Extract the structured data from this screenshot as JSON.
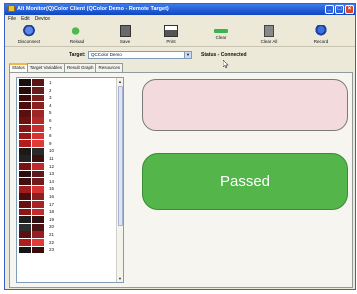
{
  "window": {
    "title": "Alt Monitor(Q)Color Client (QColor Demo - Remote Target)",
    "controls": [
      "_",
      "□",
      "×"
    ]
  },
  "menu": [
    "File",
    "Edit",
    "Device"
  ],
  "toolbar": [
    {
      "label": "Disconnect",
      "icon": "disconnect-icon"
    },
    {
      "label": "Reload",
      "icon": "reload-icon"
    },
    {
      "label": "Save",
      "icon": "save-icon"
    },
    {
      "label": "Print",
      "icon": "print-icon"
    },
    {
      "label": "Clear",
      "icon": "clear-icon"
    },
    {
      "label": "Clear All",
      "icon": "clear-all-icon"
    },
    {
      "label": "Record",
      "icon": "record-icon"
    }
  ],
  "target": {
    "label": "Target:",
    "value": "QCColor Demo",
    "status": "Status - Connected"
  },
  "tabs": [
    "Status",
    "Target Variables",
    "Result Graph",
    "Resources"
  ],
  "swatches": [
    {
      "n": "1",
      "c1": "#1a0f0f",
      "c2": "#5c1414"
    },
    {
      "n": "2",
      "c1": "#2b0a0a",
      "c2": "#6b1b1b"
    },
    {
      "n": "3",
      "c1": "#3a0b0b",
      "c2": "#7a1e1e"
    },
    {
      "n": "4",
      "c1": "#4a0c0c",
      "c2": "#8b2222"
    },
    {
      "n": "5",
      "c1": "#5a0e0e",
      "c2": "#9d2626"
    },
    {
      "n": "6",
      "c1": "#6c1010",
      "c2": "#b32a2a"
    },
    {
      "n": "7",
      "c1": "#851414",
      "c2": "#c73030"
    },
    {
      "n": "8",
      "c1": "#9c1818",
      "c2": "#d83434"
    },
    {
      "n": "9",
      "c1": "#b21c1c",
      "c2": "#e03a3a"
    },
    {
      "n": "10",
      "c1": "#1a1a1a",
      "c2": "#2a2a2a"
    },
    {
      "n": "11",
      "c1": "#222222",
      "c2": "#3b1010"
    },
    {
      "n": "12",
      "c1": "#7a1212",
      "c2": "#c02a2a"
    },
    {
      "n": "13",
      "c1": "#2c0d0d",
      "c2": "#5e1a1a"
    },
    {
      "n": "14",
      "c1": "#3d0f0f",
      "c2": "#701c1c"
    },
    {
      "n": "15",
      "c1": "#a01b1b",
      "c2": "#d93232"
    },
    {
      "n": "16",
      "c1": "#4d0c0c",
      "c2": "#8a2020"
    },
    {
      "n": "17",
      "c1": "#6a1010",
      "c2": "#a82424"
    },
    {
      "n": "18",
      "c1": "#8c1616",
      "c2": "#c42c2c"
    },
    {
      "n": "19",
      "c1": "#1e1e1e",
      "c2": "#331111"
    },
    {
      "n": "20",
      "c1": "#2e2e2e",
      "c2": "#4a1414"
    },
    {
      "n": "21",
      "c1": "#5b1010",
      "c2": "#962020"
    },
    {
      "n": "22",
      "c1": "#b01d1d",
      "c2": "#e23b3b"
    },
    {
      "n": "23",
      "c1": "#151515",
      "c2": "#3a0c0c"
    }
  ],
  "scroll": {
    "up": "▲",
    "down": "▼"
  },
  "result": {
    "label": "Passed",
    "pending_color": "#f3dadd",
    "passed_color": "#54b54a"
  }
}
